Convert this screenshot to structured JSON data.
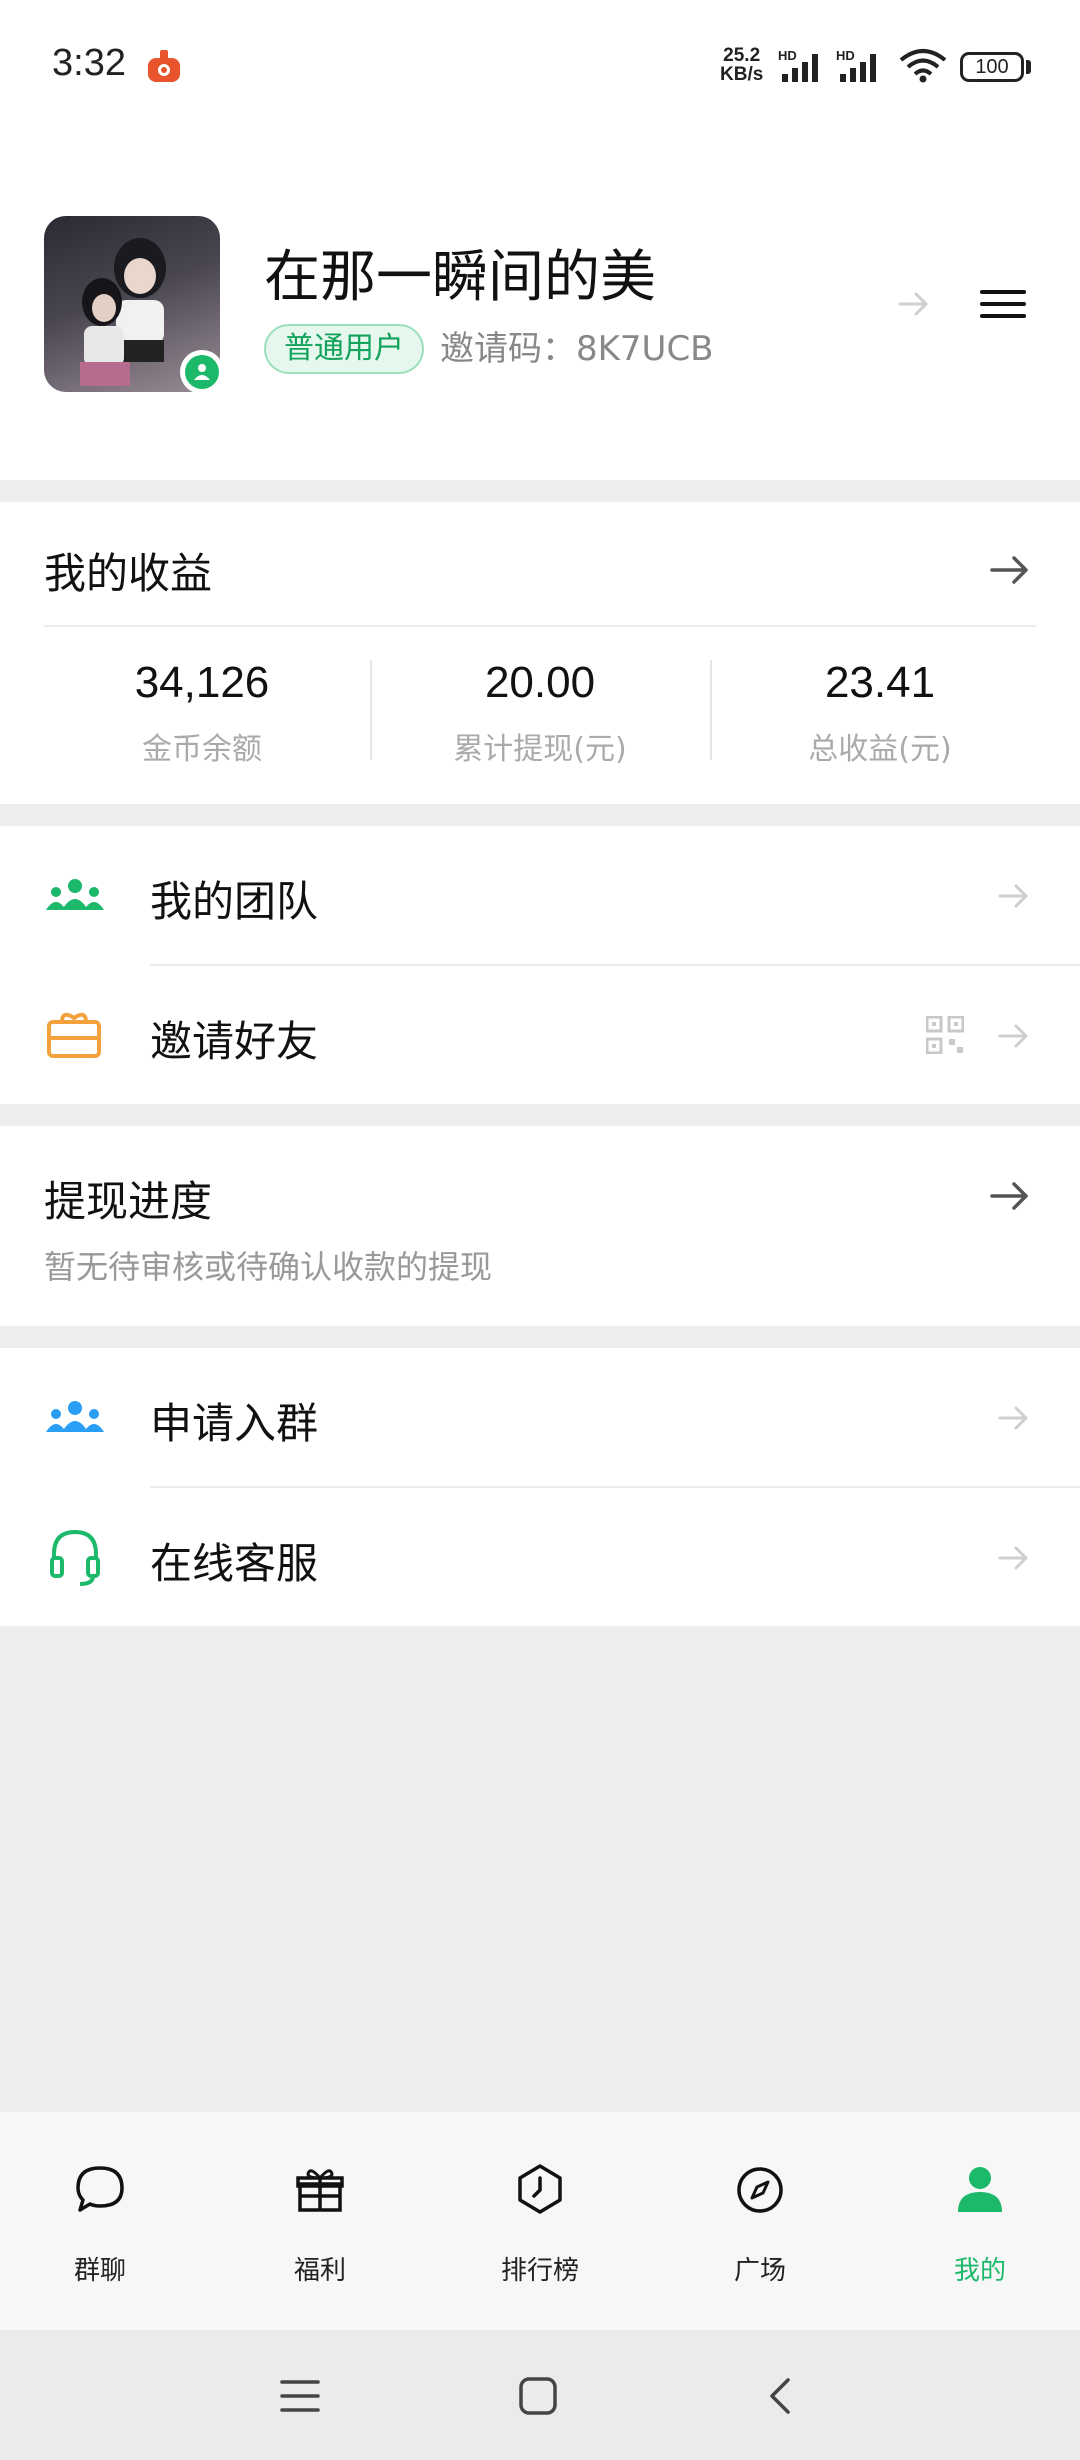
{
  "status_bar": {
    "time": "3:32",
    "speed_value": "25.2",
    "speed_unit": "KB/s",
    "battery": "100",
    "network_tag": "HD"
  },
  "profile": {
    "username": "在那一瞬间的美",
    "user_type": "普通用户",
    "invite_code": "邀请码：8K7UCB"
  },
  "earnings": {
    "title": "我的收益",
    "stats": [
      {
        "value": "34,126",
        "label": "金币余额"
      },
      {
        "value": "20.00",
        "label": "累计提现(元)"
      },
      {
        "value": "23.41",
        "label": "总收益(元)"
      }
    ]
  },
  "menu1": {
    "team": "我的团队",
    "invite": "邀请好友"
  },
  "withdraw": {
    "title": "提现进度",
    "subtitle": "暂无待审核或待确认收款的提现"
  },
  "menu2": {
    "join_group": "申请入群",
    "support": "在线客服"
  },
  "bottom_nav": [
    {
      "label": "群聊",
      "icon": "chat-bubble-icon"
    },
    {
      "label": "福利",
      "icon": "gift-icon"
    },
    {
      "label": "排行榜",
      "icon": "ranking-icon"
    },
    {
      "label": "广场",
      "icon": "compass-icon"
    },
    {
      "label": "我的",
      "icon": "person-icon",
      "active": true
    }
  ],
  "colors": {
    "accent_green": "#1cb96a",
    "team_icon": "#1cb96a",
    "invite_icon": "#f2a13d",
    "group_icon": "#2a9df4",
    "support_icon": "#1cb96a"
  }
}
